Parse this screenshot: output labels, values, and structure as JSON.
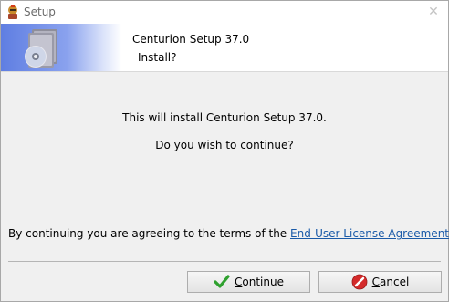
{
  "window": {
    "title": "Setup",
    "close_glyph": "✕"
  },
  "header": {
    "title": "Centurion Setup 37.0",
    "subtitle": "Install?",
    "banner_icon": "cd-case-icon"
  },
  "body": {
    "line1": "This will install Centurion Setup 37.0.",
    "line2": "Do you wish to continue?"
  },
  "agreement": {
    "prefix": "By continuing you are agreeing to the terms of the ",
    "link_text": "End-User License Agreement",
    "suffix": "."
  },
  "buttons": {
    "continue_label": "Continue",
    "cancel_label": "Cancel"
  },
  "colors": {
    "link": "#1a5aa8",
    "continue_icon": "#2fa12f",
    "cancel_icon": "#d42a2a"
  }
}
